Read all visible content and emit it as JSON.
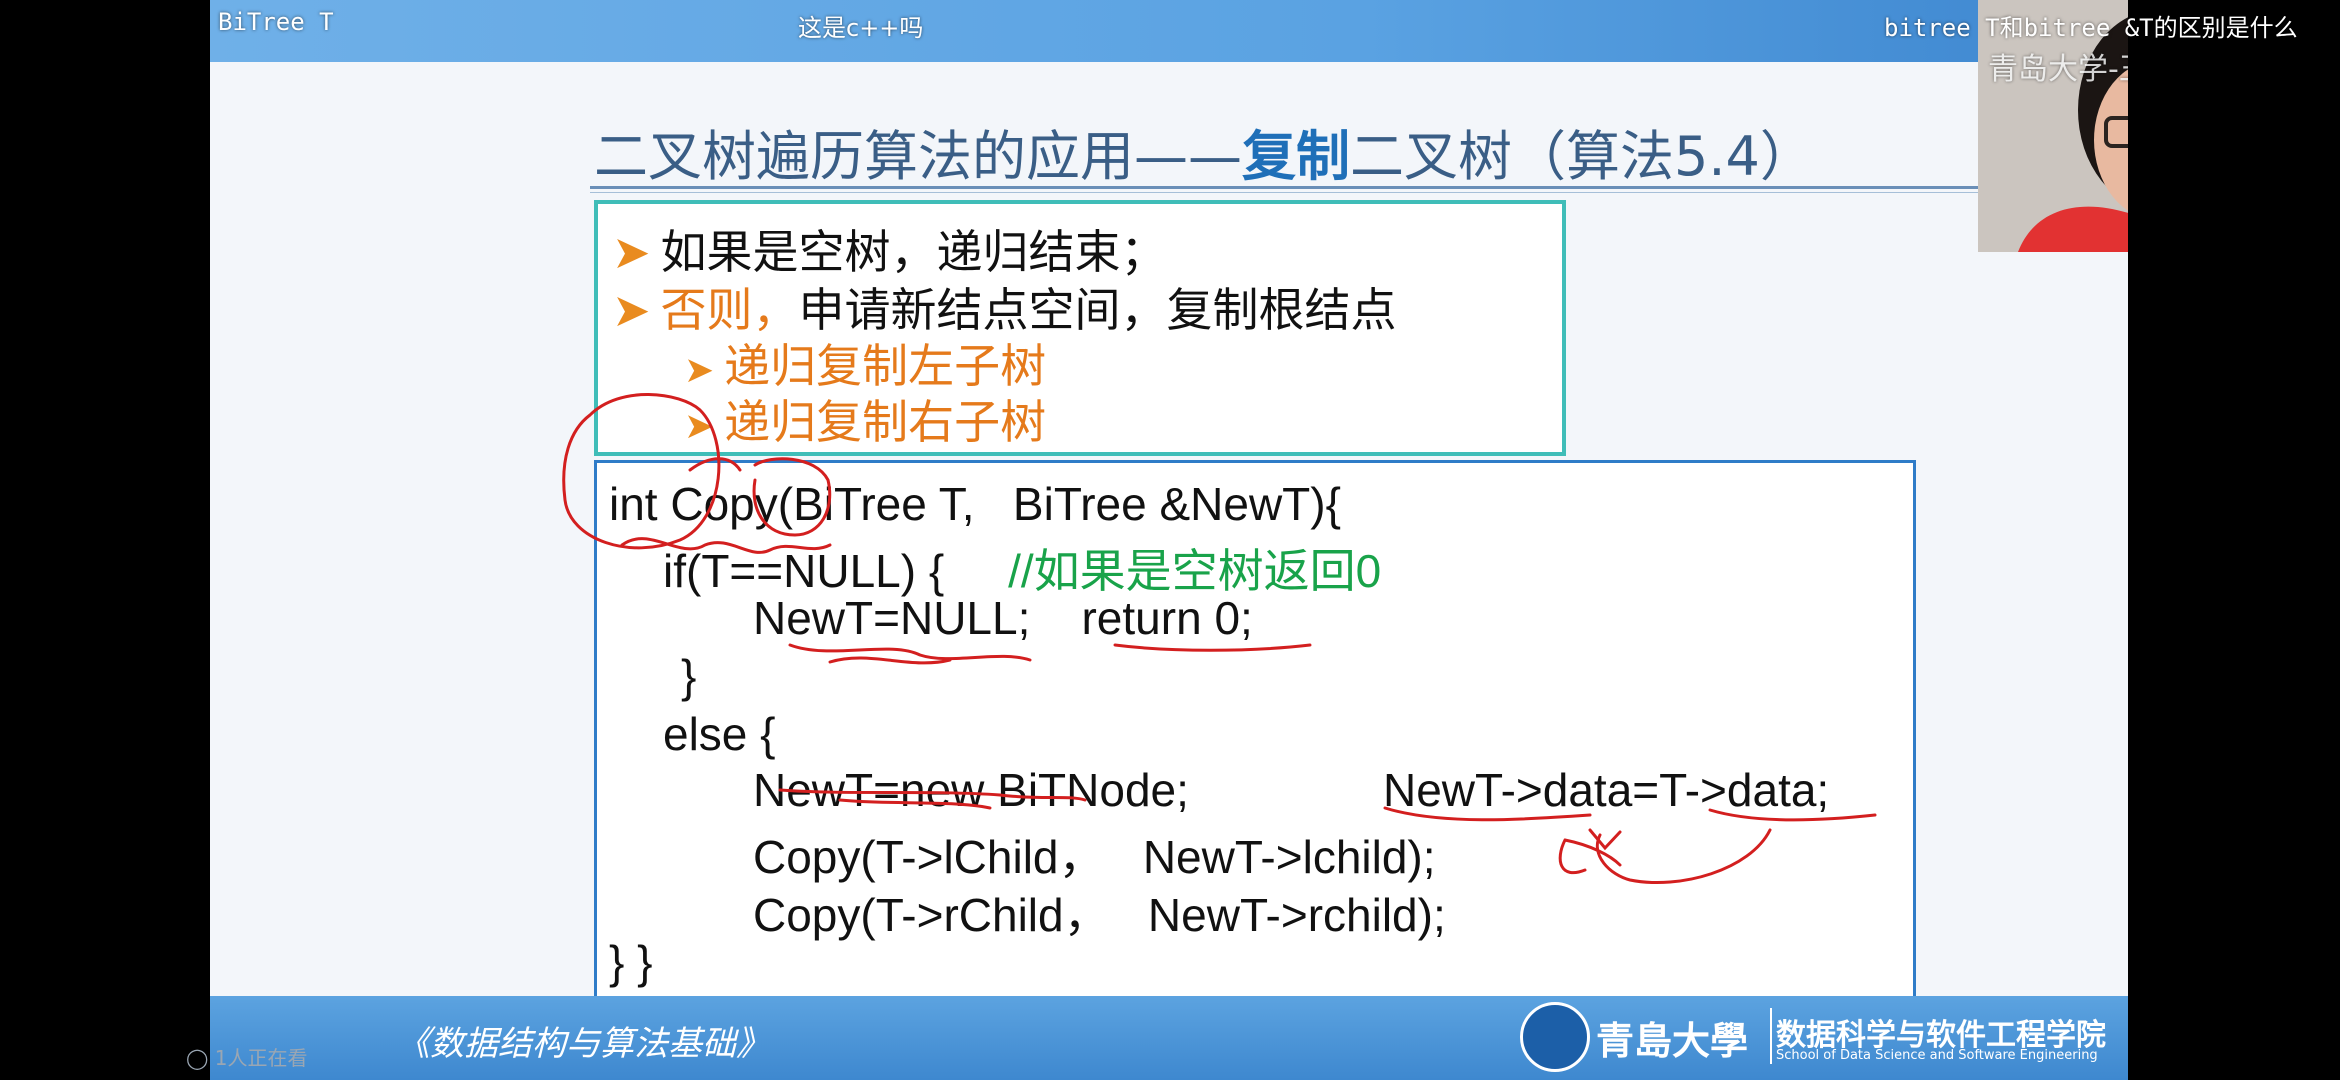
{
  "overlay": {
    "left_title": "BiTree T",
    "center_comment": "这是c++吗",
    "right_comment": "bitree T和bitree &T的区别是什么",
    "watermark": "青岛大学-王卓",
    "viewers": "1人正在看"
  },
  "slide": {
    "title_part1": "二叉树遍历算法的应用——",
    "title_highlight": "复制",
    "title_part2": "二叉树（算法5.4）",
    "bullets": [
      {
        "prefix": "",
        "text": "如果是空树，递归结束；"
      },
      {
        "prefix": "否则，",
        "text": "申请新结点空间，复制根结点"
      },
      {
        "prefix": "",
        "text": "递归复制左子树"
      },
      {
        "prefix": "",
        "text": "递归复制右子树"
      }
    ],
    "code": {
      "line1": "int Copy(BiTree T,   BiTree &NewT){",
      "line2a": "if(T==NULL) {     ",
      "line2b": "//如果是空树返回0",
      "line3": "NewT=NULL;    return 0;",
      "line4": "}",
      "line5": "else {",
      "line6a": "NewT=new BiTNode;",
      "line6b": "NewT->data=T->data;",
      "line7": "Copy(T->lChild，   NewT->lchild);",
      "line8": "Copy(T->rChild，   NewT->rchild);",
      "line9": "} }"
    },
    "footer_book": "《数据结构与算法基础》",
    "footer_university": "青島大學",
    "footer_school": "数据科学与软件工程学院",
    "footer_school_en": "School of Data Science and Software Engineering"
  },
  "colors": {
    "title": "#3a5e86",
    "highlight": "#1f6fb8",
    "bullet_orange": "#e57a1b",
    "comment_green": "#19a34a",
    "annotation_red": "#d31f1f"
  }
}
